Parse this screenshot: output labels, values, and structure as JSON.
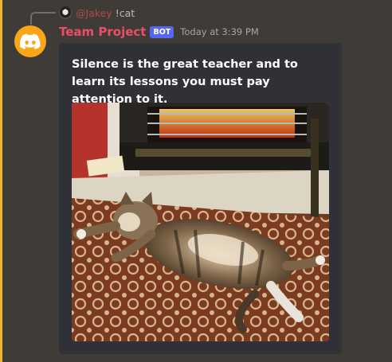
{
  "reply": {
    "username": "@Jakey",
    "content": "!cat"
  },
  "message": {
    "username": "Team Project",
    "bot_tag": "BOT",
    "timestamp": "Today at 3:39 PM",
    "avatar_icon": "discord-logo-icon",
    "username_color": "#ed4d6a",
    "avatar_color": "#faa61a"
  },
  "embed": {
    "description": "Silence is the great teacher and to learn its lessons you must pay attention to it.",
    "image_alt": "cat lying on rug by fireplace"
  },
  "colors": {
    "mention_highlight": "#f0b232",
    "bot_tag": "#5865f2",
    "embed_bg": "#2f3136"
  }
}
